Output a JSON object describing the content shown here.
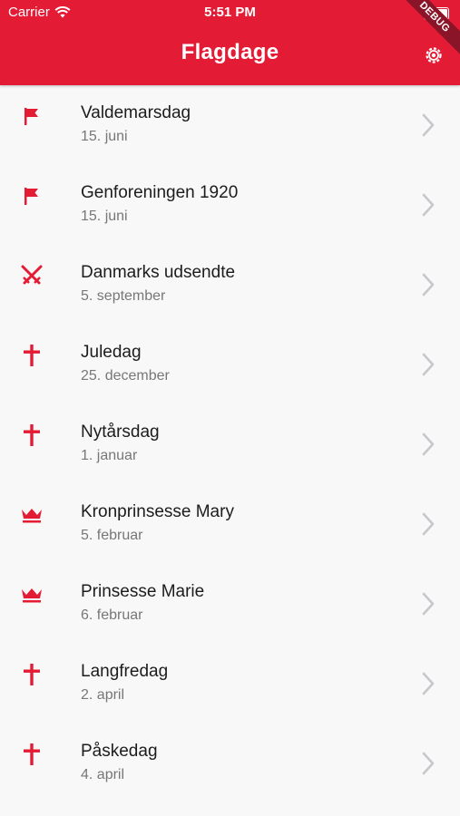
{
  "status_bar": {
    "carrier": "Carrier",
    "time": "5:51 PM"
  },
  "app_bar": {
    "title": "Flagdage",
    "debug_label": "DEBUG",
    "background": "#e31b34"
  },
  "days": [
    {
      "name": "Valdemarsdag",
      "date": "15. juni",
      "icon": "flag-icon"
    },
    {
      "name": "Genforeningen 1920",
      "date": "15. juni",
      "icon": "flag-icon"
    },
    {
      "name": "Danmarks udsendte",
      "date": "5. september",
      "icon": "crossed-swords-icon"
    },
    {
      "name": "Juledag",
      "date": "25. december",
      "icon": "cross-icon"
    },
    {
      "name": "Nytårsdag",
      "date": "1. januar",
      "icon": "cross-icon"
    },
    {
      "name": "Kronprinsesse Mary",
      "date": "5. februar",
      "icon": "crown-icon"
    },
    {
      "name": "Prinsesse Marie",
      "date": "6. februar",
      "icon": "crown-icon"
    },
    {
      "name": "Langfredag",
      "date": "2. april",
      "icon": "cross-icon"
    },
    {
      "name": "Påskedag",
      "date": "4. april",
      "icon": "cross-icon"
    }
  ]
}
